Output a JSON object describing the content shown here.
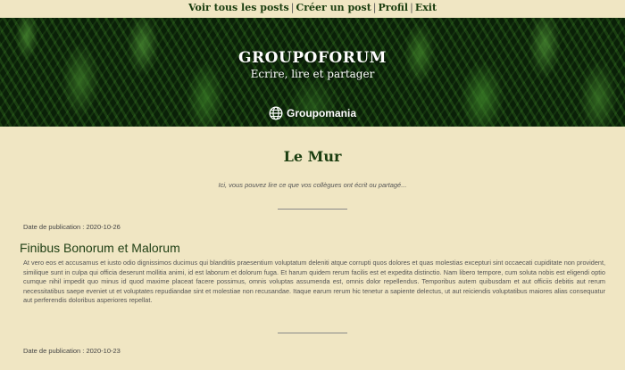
{
  "nav": {
    "items": [
      {
        "label": "Voir tous les posts"
      },
      {
        "label": "Créer un post"
      },
      {
        "label": "Profil"
      },
      {
        "label": "Exit"
      }
    ],
    "separator": "|"
  },
  "banner": {
    "title": "GROUPOFORUM",
    "subtitle": "Ecrire, lire et partager",
    "brand": "Groupomania",
    "brand_icon": "globe-icon"
  },
  "wall": {
    "title": "Le Mur",
    "intro": "Ici, vous pouvez lire ce que vos collègues ont écrit ou partagé..."
  },
  "posts": [
    {
      "date_label": "Date de publication : 2020-10-26",
      "title": "Finibus Bonorum et Malorum",
      "body": "At vero eos et accusamus et iusto odio dignissimos ducimus qui blanditiis praesentium voluptatum deleniti atque corrupti quos dolores et quas molestias excepturi sint occaecati cupiditate non provident, similique sunt in culpa qui officia deserunt mollitia animi, id est laborum et dolorum fuga. Et harum quidem rerum facilis est et expedita distinctio. Nam libero tempore, cum soluta nobis est eligendi optio cumque nihil impedit quo minus id quod maxime placeat facere possimus, omnis voluptas assumenda est, omnis dolor repellendus. Temporibus autem quibusdam et aut officiis debitis aut rerum necessitatibus saepe eveniet ut et voluptates repudiandae sint et molestiae non recusandae. Itaque earum rerum hic tenetur a sapiente delectus, ut aut reiciendis voluptatibus maiores alias consequatur aut perferendis doloribus asperiores repellat."
    },
    {
      "date_label": "Date de publication : 2020-10-23"
    }
  ],
  "colors": {
    "background": "#f0e6c3",
    "heading_green": "#1a3d0f"
  }
}
